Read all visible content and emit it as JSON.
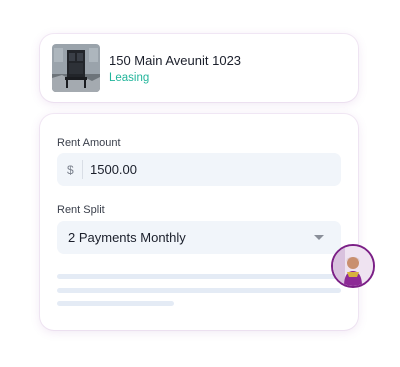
{
  "property": {
    "title": "150 Main Aveunit 1023",
    "status": "Leasing",
    "thumbnail_icon": "building-photo"
  },
  "form": {
    "rent_amount": {
      "label": "Rent Amount",
      "currency_symbol": "$",
      "value": "1500.00"
    },
    "rent_split": {
      "label": "Rent Split",
      "selected": "2 Payments Monthly",
      "icon": "caret-down-icon"
    }
  },
  "user": {
    "avatar_icon": "user-avatar"
  },
  "colors": {
    "status_green": "#22b59b",
    "field_bg": "#f1f5fa",
    "avatar_border": "#7b1f86"
  }
}
